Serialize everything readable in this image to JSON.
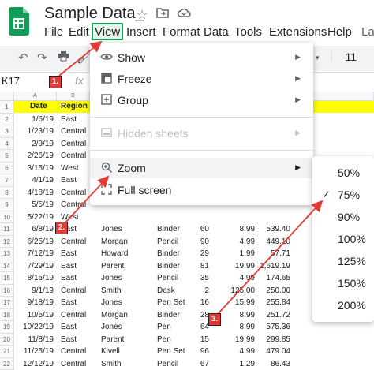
{
  "header": {
    "title": "Sample Data_",
    "icons": [
      "star-icon",
      "folder-move-icon",
      "cloud-status-icon"
    ]
  },
  "menubar": {
    "items": [
      "File",
      "Edit",
      "View",
      "Insert",
      "Format",
      "Data",
      "Tools",
      "Extensions",
      "Help",
      "La"
    ]
  },
  "toolbar": {
    "font_size": "11"
  },
  "formula_bar": {
    "cell_ref": "K17",
    "fx_label": "fx"
  },
  "sheet": {
    "col_headers": [
      "A",
      "B"
    ],
    "header_row": [
      "Date",
      "Region"
    ],
    "row_numbers": [
      "1",
      "2",
      "3",
      "4",
      "5",
      "6",
      "7",
      "8",
      "9",
      "10",
      "11",
      "12",
      "13",
      "14",
      "15",
      "16",
      "17",
      "18",
      "19",
      "20",
      "21",
      "22"
    ],
    "rows": [
      {
        "date": "1/6/19",
        "region": "East"
      },
      {
        "date": "1/23/19",
        "region": "Central"
      },
      {
        "date": "2/9/19",
        "region": "Central"
      },
      {
        "date": "2/26/19",
        "region": "Central"
      },
      {
        "date": "3/15/19",
        "region": "West"
      },
      {
        "date": "4/1/19",
        "region": "East"
      },
      {
        "date": "4/18/19",
        "region": "Central"
      },
      {
        "date": "5/5/19",
        "region": "Central"
      },
      {
        "date": "5/22/19",
        "region": "West"
      },
      {
        "date": "6/8/19",
        "region": "East",
        "rep": "Jones",
        "item": "Binder",
        "units": "60",
        "cost": "8.99",
        "total": "539.40"
      },
      {
        "date": "6/25/19",
        "region": "Central",
        "rep": "Morgan",
        "item": "Pencil",
        "units": "90",
        "cost": "4.99",
        "total": "449.10"
      },
      {
        "date": "7/12/19",
        "region": "East",
        "rep": "Howard",
        "item": "Binder",
        "units": "29",
        "cost": "1.99",
        "total": "57.71"
      },
      {
        "date": "7/29/19",
        "region": "East",
        "rep": "Parent",
        "item": "Binder",
        "units": "81",
        "cost": "19.99",
        "total": "1,619.19"
      },
      {
        "date": "8/15/19",
        "region": "East",
        "rep": "Jones",
        "item": "Pencil",
        "units": "35",
        "cost": "4.99",
        "total": "174.65"
      },
      {
        "date": "9/1/19",
        "region": "Central",
        "rep": "Smith",
        "item": "Desk",
        "units": "2",
        "cost": "125.00",
        "total": "250.00"
      },
      {
        "date": "9/18/19",
        "region": "East",
        "rep": "Jones",
        "item": "Pen Set",
        "units": "16",
        "cost": "15.99",
        "total": "255.84"
      },
      {
        "date": "10/5/19",
        "region": "Central",
        "rep": "Morgan",
        "item": "Binder",
        "units": "28",
        "cost": "8.99",
        "total": "251.72"
      },
      {
        "date": "10/22/19",
        "region": "East",
        "rep": "Jones",
        "item": "Pen",
        "units": "64",
        "cost": "8.99",
        "total": "575.36"
      },
      {
        "date": "11/8/19",
        "region": "East",
        "rep": "Parent",
        "item": "Pen",
        "units": "15",
        "cost": "19.99",
        "total": "299.85"
      },
      {
        "date": "11/25/19",
        "region": "Central",
        "rep": "Kivell",
        "item": "Pen Set",
        "units": "96",
        "cost": "4.99",
        "total": "479.04"
      },
      {
        "date": "12/12/19",
        "region": "Central",
        "rep": "Smith",
        "item": "Pencil",
        "units": "67",
        "cost": "1.29",
        "total": "86.43"
      }
    ]
  },
  "view_menu": {
    "show": "Show",
    "freeze": "Freeze",
    "group": "Group",
    "hidden_sheets": "Hidden sheets",
    "zoom": "Zoom",
    "full_screen": "Full screen"
  },
  "zoom_menu": {
    "options": [
      "50%",
      "75%",
      "90%",
      "100%",
      "125%",
      "150%",
      "200%"
    ],
    "selected": "75%"
  },
  "callouts": {
    "step1": "1.",
    "step2": "2.",
    "step3": "3.",
    "color": "#e53935"
  }
}
